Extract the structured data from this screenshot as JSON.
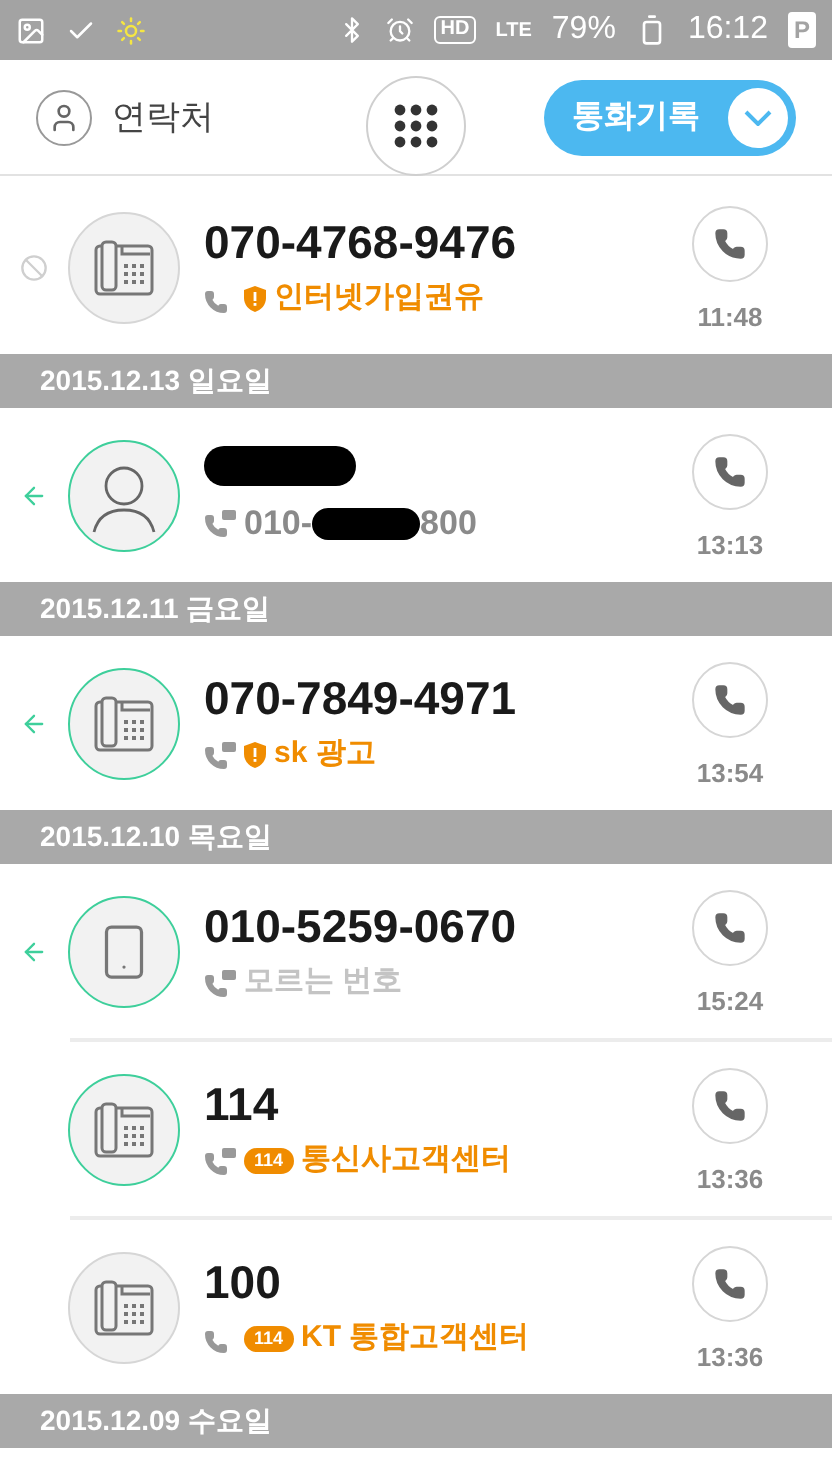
{
  "status_bar": {
    "hd": "HD",
    "network": "LTE",
    "battery": "79%",
    "time": "16:12",
    "corner": "P"
  },
  "header": {
    "contacts_label": "연락처",
    "call_log_label": "통화기록"
  },
  "entries": [
    {
      "kind": "call",
      "number": "070-4768-9476",
      "blocked": true,
      "incoming": false,
      "avatar": {
        "kind": "landline",
        "highlighted": false
      },
      "hd": false,
      "tag": {
        "kind": "shield"
      },
      "label": "인터넷가입권유",
      "muted": false,
      "time": "11:48"
    },
    {
      "kind": "date",
      "text": "2015.12.13 일요일"
    },
    {
      "kind": "call",
      "name_redacted": true,
      "number": "010-",
      "number_end": "800",
      "blocked": false,
      "incoming": true,
      "avatar": {
        "kind": "person",
        "highlighted": true
      },
      "hd": true,
      "time": "13:13"
    },
    {
      "kind": "date",
      "text": "2015.12.11 금요일"
    },
    {
      "kind": "call",
      "number": "070-7849-4971",
      "blocked": false,
      "incoming": true,
      "avatar": {
        "kind": "landline",
        "highlighted": true
      },
      "hd": true,
      "tag": {
        "kind": "shield"
      },
      "label": "sk 광고",
      "muted": false,
      "time": "13:54"
    },
    {
      "kind": "date",
      "text": "2015.12.10 목요일"
    },
    {
      "kind": "call",
      "number": "010-5259-0670",
      "blocked": false,
      "incoming": true,
      "avatar": {
        "kind": "mobile",
        "highlighted": true
      },
      "hd": true,
      "label": "모르는 번호",
      "muted": true,
      "time": "15:24"
    },
    {
      "kind": "call",
      "number": "114",
      "blocked": false,
      "incoming": false,
      "avatar": {
        "kind": "landline",
        "highlighted": true
      },
      "hd": true,
      "tag": {
        "kind": "badge",
        "text": "114"
      },
      "label": "통신사고객센터",
      "muted": false,
      "time": "13:36",
      "divider": true
    },
    {
      "kind": "call",
      "number": "100",
      "blocked": false,
      "incoming": false,
      "avatar": {
        "kind": "landline",
        "highlighted": false
      },
      "hd": false,
      "tag": {
        "kind": "badge",
        "text": "114"
      },
      "label": "KT 통합고객센터",
      "muted": false,
      "time": "13:36",
      "divider": true
    },
    {
      "kind": "date",
      "text": "2015.12.09 수요일"
    }
  ]
}
